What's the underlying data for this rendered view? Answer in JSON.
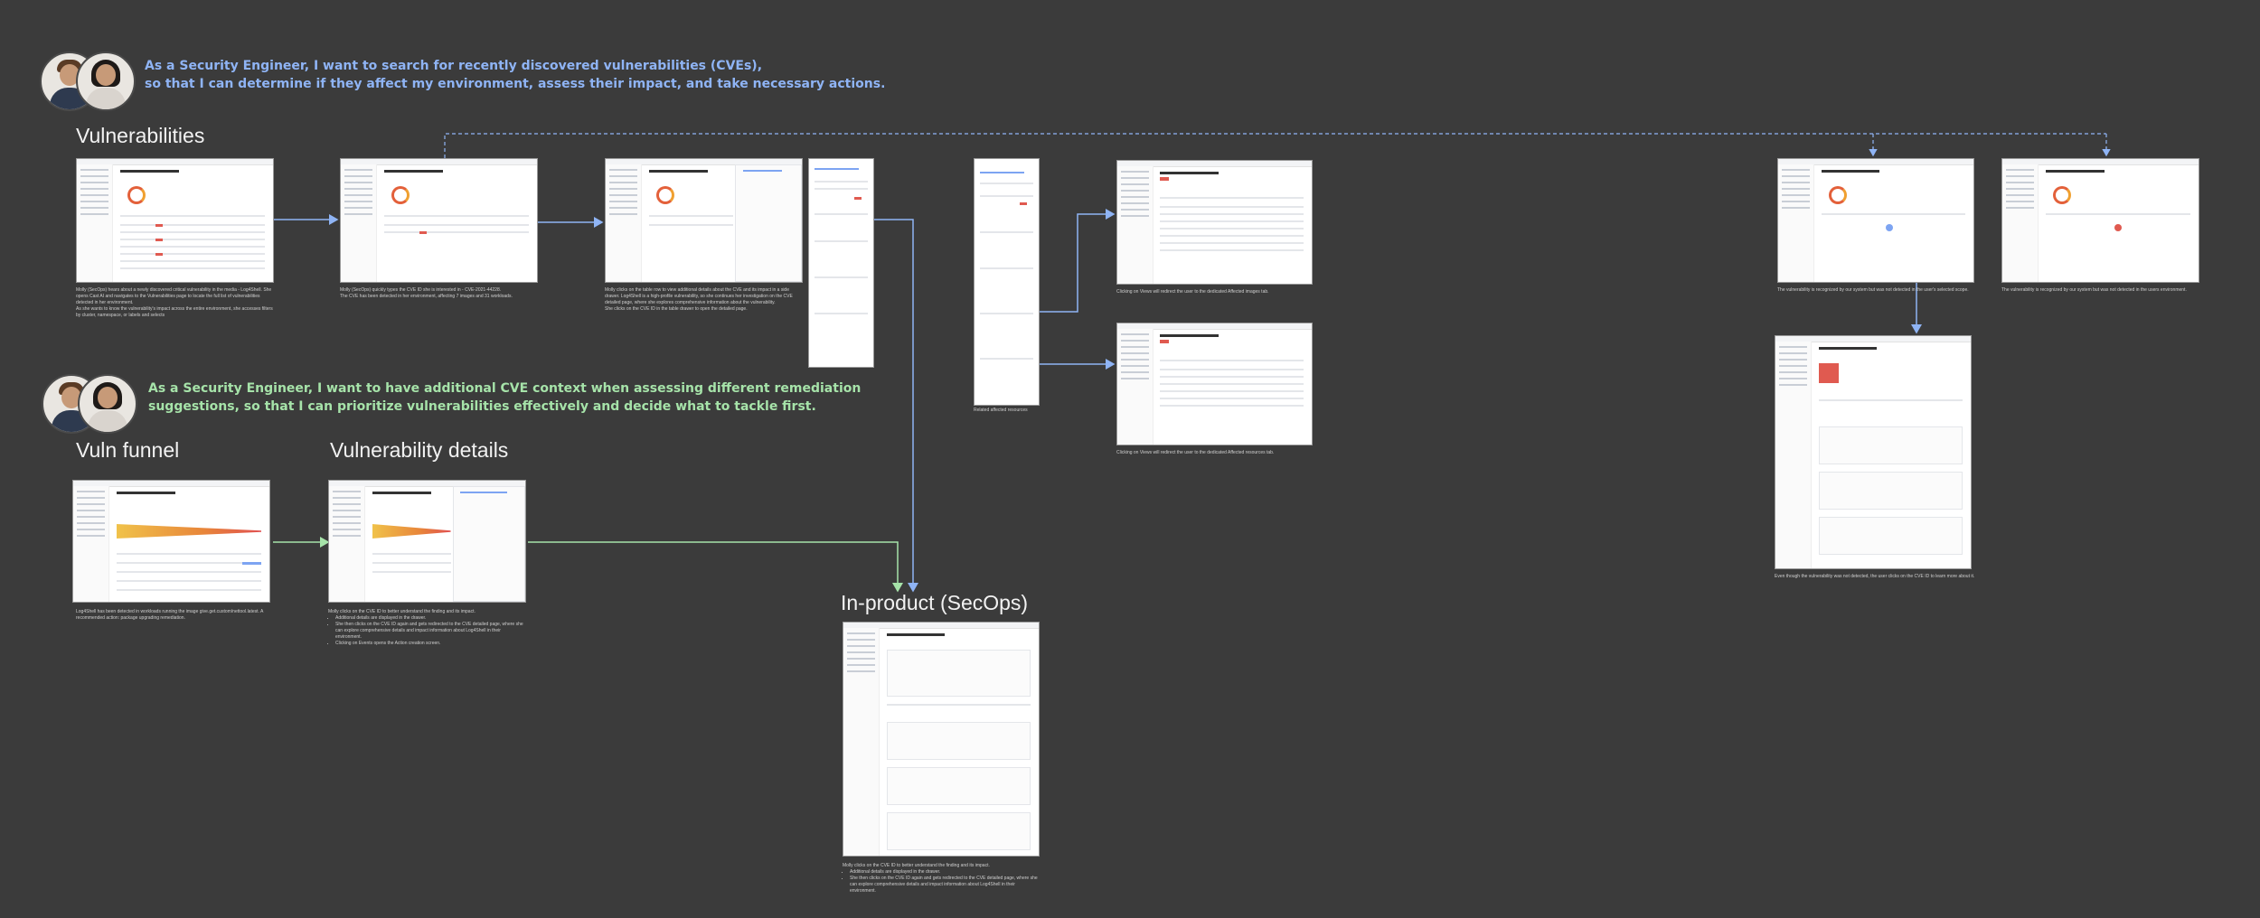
{
  "stories": {
    "search": {
      "line1": "As a Security Engineer, I want to search for recently discovered vulnerabilities (CVEs),",
      "line2": "so that I can determine if they affect my environment, assess their impact, and take necessary actions."
    },
    "context": {
      "line1": "As a Security Engineer, I want to have additional CVE context when assessing different remediation",
      "line2": "suggestions, so that I can prioritize vulnerabilities effectively and decide what to tackle first."
    }
  },
  "sections": {
    "vulnerabilities": "Vulnerabilities",
    "vuln_funnel": "Vuln funnel",
    "vulnerability_details": "Vulnerability details",
    "in_product": "In-product (SecOps)"
  },
  "screens": {
    "vuln_mgmt_title": "Vulnerability management",
    "cve_title": "CVE-2021-44228 (Log4Shell)",
    "score": "9.4"
  },
  "captions": {
    "c1": "Molly (SecOps) hears about a newly discovered critical vulnerability in the media - Log4Shell. She opens Cast AI and navigates to the Vulnerabilities page to locate the full list of vulnerabilities detected in her environment.",
    "c1b": "As she wants to know the vulnerability's impact across the entire environment, she accesses filters by cluster, namespace, or labels and selects",
    "c2": "Molly (SecOps) quickly types the CVE ID she is interested in - CVE-2021-44228.",
    "c2b": "The CVE has been detected in her environment, affecting 7 images and 31 workloads.",
    "c3": "Molly clicks on the table row to view additional details about the CVE and its impact in a side drawer. Log4Shell is a high-profile vulnerability, so she continues her investigation on the CVE detailed page, where she explores comprehensive information about the vulnerability.",
    "c3b": "She clicks on the CVE ID in the table drawer to open the detailed page.",
    "c4": "Related affected resources",
    "c5": "Clicking on Views will redirect the user to the dedicated Affected images tab.",
    "c6": "Clicking on Views will redirect the user to the dedicated Affected resources tab.",
    "c7": "The vulnerability is recognized by our system but was not detected in the user's selected scope.",
    "c8": "The vulnerability is recognized by our system but was not detected in the users environment.",
    "c9": "Even though the vulnerability was not detected, the user clicks on the CVE ID to learn more about it.",
    "c10": "Log4Shell has been detected in workloads running the image give.get.custom/nettool.latest. A recommended action: package upgrading remediation.",
    "c11": "Molly clicks on the CVE ID to better understand the finding and its impact.",
    "c11_items": [
      "Additional details are displayed in the drawer.",
      "She then clicks on the CVE ID again and gets redirected to the CVE detailed page, where she can explore comprehensive details and impact information about Log4Shell in their environment.",
      "Clicking on Events opens the Action creation screen."
    ],
    "c12": "Molly clicks on the CVE ID to better understand the finding and its impact.",
    "c12_items": [
      "Additional details are displayed in the drawer.",
      "She then clicks on the CVE ID again and gets redirected to the CVE detailed page, where she can explore comprehensive details and impact information about Log4Shell in their environment."
    ]
  },
  "colors": {
    "background": "#3b3b3b",
    "story_blue": "#8fb4f5",
    "story_green": "#a6e3a9",
    "arrow_blue": "#8fb4f5",
    "arrow_green": "#a6e3a9"
  }
}
